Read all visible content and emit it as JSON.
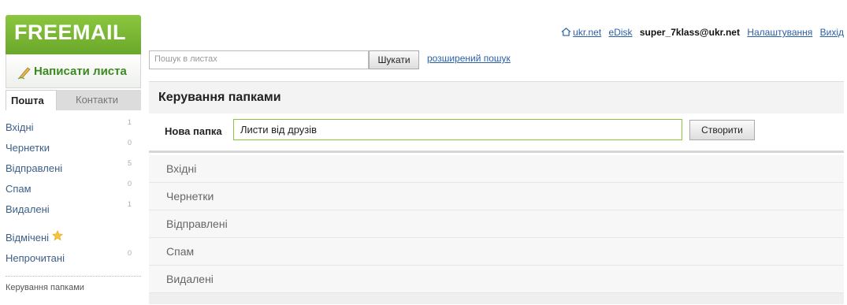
{
  "logo": "FREEMAIL",
  "compose": {
    "label": "Написати листа",
    "icon": "pen-icon"
  },
  "tabs": {
    "mail": "Пошта",
    "contacts": "Контакти"
  },
  "sidebar": {
    "items": [
      {
        "label": "Вхідні",
        "count": "1"
      },
      {
        "label": "Чернетки",
        "count": "0"
      },
      {
        "label": "Відправлені",
        "count": "5"
      },
      {
        "label": "Спам",
        "count": "0"
      },
      {
        "label": "Видалені",
        "count": "1"
      }
    ],
    "starred": {
      "label": "Відмічені",
      "icon": "star-icon"
    },
    "unread": {
      "label": "Непрочитані",
      "count": "0"
    },
    "manage": "Керування папками"
  },
  "header": {
    "home": "ukr.net",
    "edisk": "eDisk",
    "email": "super_7klass@ukr.net",
    "settings": "Налаштування",
    "logout": "Вихід"
  },
  "search": {
    "placeholder": "Пошук в листах",
    "button": "Шукати",
    "advanced": "розширений пошук"
  },
  "main": {
    "title": "Керування папками",
    "new_folder_label": "Нова папка",
    "new_folder_value": "Листи від друзів",
    "create_button": "Створити",
    "folders": [
      "Вхідні",
      "Чернетки",
      "Відправлені",
      "Спам",
      "Видалені"
    ]
  },
  "colors": {
    "brand_green": "#8cc63f",
    "link_blue": "#2a5fa8"
  }
}
